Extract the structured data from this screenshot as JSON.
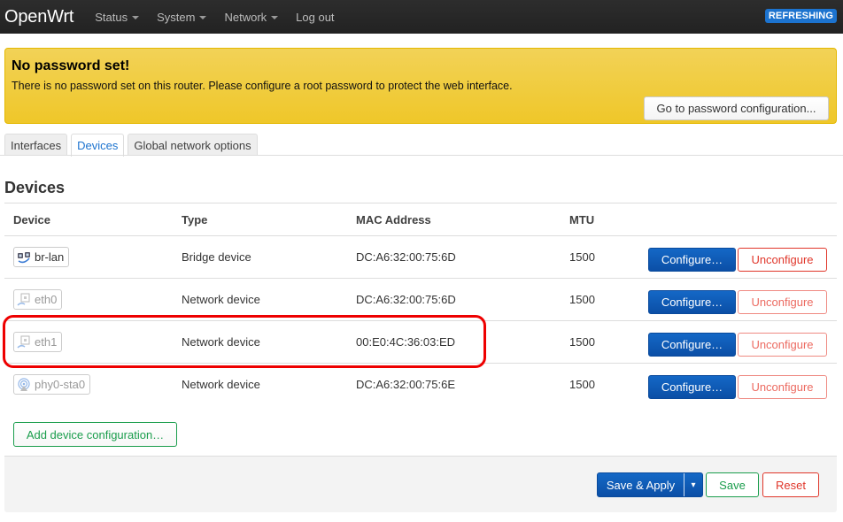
{
  "navbar": {
    "brand": "OpenWrt",
    "menus": [
      {
        "label": "Status",
        "dropdown": true
      },
      {
        "label": "System",
        "dropdown": true
      },
      {
        "label": "Network",
        "dropdown": true
      },
      {
        "label": "Log out",
        "dropdown": false
      }
    ],
    "status_badge": "REFRESHING"
  },
  "alert": {
    "title": "No password set!",
    "message": "There is no password set on this router. Please configure a root password to protect the web interface.",
    "button": "Go to password configuration..."
  },
  "tabs": [
    {
      "label": "Interfaces",
      "active": false
    },
    {
      "label": "Devices",
      "active": true
    },
    {
      "label": "Global network options",
      "active": false
    }
  ],
  "section_title": "Devices",
  "table": {
    "headers": [
      "Device",
      "Type",
      "MAC Address",
      "MTU"
    ],
    "rows": [
      {
        "device": "br-lan",
        "icon": "bridge-icon",
        "enabled": true,
        "type": "Bridge device",
        "mac": "DC:A6:32:00:75:6D",
        "mtu": "1500",
        "configure": "Configure…",
        "unconfigure": "Unconfigure",
        "unconfigure_enabled": true
      },
      {
        "device": "eth0",
        "icon": "ethernet-icon",
        "enabled": false,
        "type": "Network device",
        "mac": "DC:A6:32:00:75:6D",
        "mtu": "1500",
        "configure": "Configure…",
        "unconfigure": "Unconfigure",
        "unconfigure_enabled": false
      },
      {
        "device": "eth1",
        "icon": "ethernet-icon",
        "enabled": false,
        "type": "Network device",
        "mac": "00:E0:4C:36:03:ED",
        "mtu": "1500",
        "configure": "Configure…",
        "unconfigure": "Unconfigure",
        "unconfigure_enabled": false,
        "highlighted": true
      },
      {
        "device": "phy0-sta0",
        "icon": "wifi-icon",
        "enabled": false,
        "type": "Network device",
        "mac": "DC:A6:32:00:75:6E",
        "mtu": "1500",
        "configure": "Configure…",
        "unconfigure": "Unconfigure",
        "unconfigure_enabled": false
      }
    ]
  },
  "add_button": "Add device configuration…",
  "footer": {
    "save_apply": "Save & Apply",
    "save_apply_dropdown": "▾",
    "save": "Save",
    "reset": "Reset"
  },
  "colors": {
    "accent_blue": "#1c73cf",
    "primary_button": "#0b4fa6",
    "danger": "#e0362a",
    "success": "#1a9d4c",
    "alert_yellow": "#efc729",
    "highlight_red": "#ee0000"
  }
}
